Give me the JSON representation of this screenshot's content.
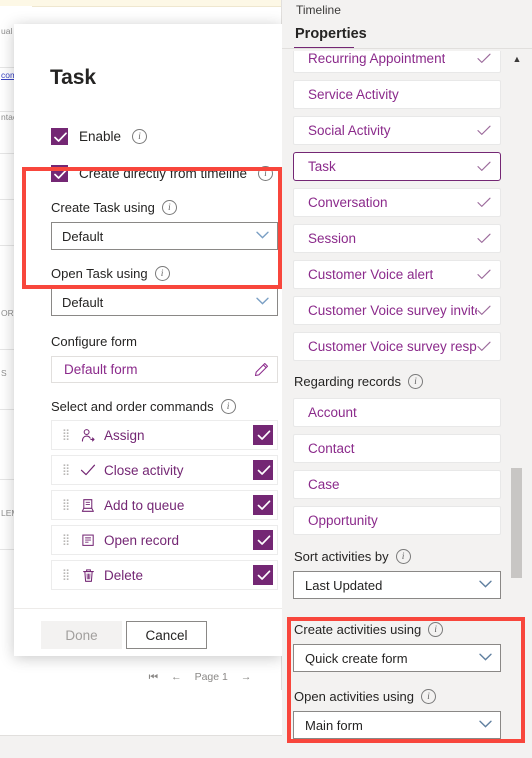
{
  "background": {
    "rows": [
      {
        "text": "ual ",
        "link": false
      },
      {
        "text": "com",
        "link": true
      },
      {
        "text": "ntac",
        "link": false
      },
      {
        "text": "",
        "link": false
      },
      {
        "text": "",
        "link": false
      },
      {
        "text": "ORTU",
        "link": false
      },
      {
        "text": "S",
        "link": false
      },
      {
        "text": "",
        "link": false
      },
      {
        "text": "LEM",
        "link": false
      }
    ],
    "pagination": {
      "first_icon": "⏮",
      "prev_icon": "←",
      "page_label": "Page 1",
      "next_icon": "→"
    },
    "scroll_down_icon": "▼"
  },
  "dialog": {
    "title": "Task",
    "checkboxes": [
      {
        "label": "Enable",
        "checked": true,
        "info": true
      },
      {
        "label": "Create directly from timeline",
        "checked": true,
        "info": true
      }
    ],
    "fields": [
      {
        "label": "Create Task using",
        "value": "Default",
        "info": true
      },
      {
        "label": "Open Task using",
        "value": "Default",
        "info": true
      }
    ],
    "configure_form": {
      "label": "Configure form",
      "value": "Default form",
      "edit_icon": "pencil-icon"
    },
    "commands_section": {
      "label": "Select and order commands",
      "info": true,
      "items": [
        {
          "name": "Assign",
          "icon": "assign-person-icon",
          "checked": true
        },
        {
          "name": "Close activity",
          "icon": "checkmark-icon",
          "checked": true
        },
        {
          "name": "Add to queue",
          "icon": "queue-icon",
          "checked": true
        },
        {
          "name": "Open record",
          "icon": "open-record-icon",
          "checked": true
        },
        {
          "name": "Delete",
          "icon": "trash-icon",
          "checked": true
        }
      ]
    },
    "footer": {
      "done_label": "Done",
      "done_disabled": true,
      "cancel_label": "Cancel"
    },
    "accent_color": "#742774",
    "highlight_color": "#f8463c"
  },
  "right_panel": {
    "breadcrumb": "Timeline",
    "tab": "Properties",
    "activities": [
      {
        "name": "Recurring Appointment",
        "checked": true,
        "selected": false,
        "clipped": true
      },
      {
        "name": "Service Activity",
        "checked": false,
        "selected": false
      },
      {
        "name": "Social Activity",
        "checked": true,
        "selected": false
      },
      {
        "name": "Task",
        "checked": true,
        "selected": true
      },
      {
        "name": "Conversation",
        "checked": true,
        "selected": false
      },
      {
        "name": "Session",
        "checked": true,
        "selected": false
      },
      {
        "name": "Customer Voice alert",
        "checked": true,
        "selected": false
      },
      {
        "name": "Customer Voice survey invite",
        "checked": true,
        "selected": false
      },
      {
        "name": "Customer Voice survey response",
        "checked": true,
        "selected": false
      }
    ],
    "regarding_records": {
      "label": "Regarding records",
      "info": true,
      "items": [
        {
          "name": "Account"
        },
        {
          "name": "Contact"
        },
        {
          "name": "Case"
        },
        {
          "name": "Opportunity"
        }
      ]
    },
    "sort_activities": {
      "label": "Sort activities by",
      "value": "Last Updated",
      "info": true
    },
    "create_activities": {
      "label": "Create activities using",
      "value": "Quick create form",
      "info": true
    },
    "open_activities": {
      "label": "Open activities using",
      "value": "Main form",
      "info": true
    },
    "scroll_up_icon": "▲"
  }
}
